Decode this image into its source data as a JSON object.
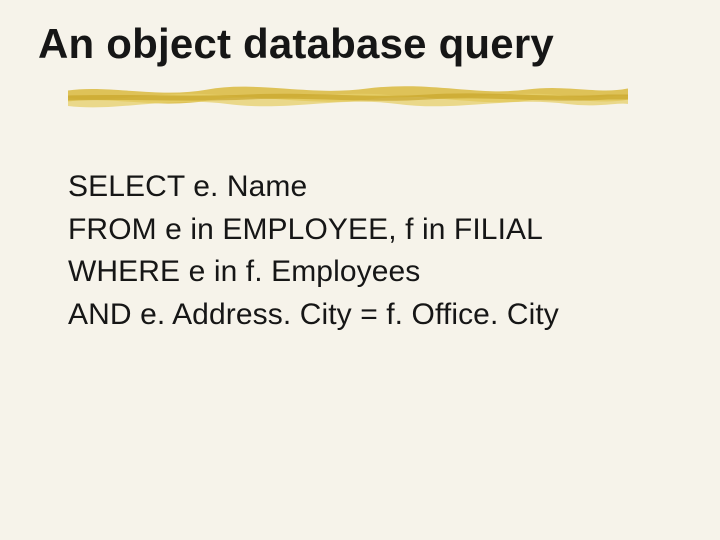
{
  "title": "An object database query",
  "query": {
    "line1": "SELECT e. Name",
    "line2": "FROM e in EMPLOYEE, f in FILIAL",
    "line3": "WHERE e in f. Employees",
    "line4": "AND e. Address. City = f. Office. City"
  }
}
